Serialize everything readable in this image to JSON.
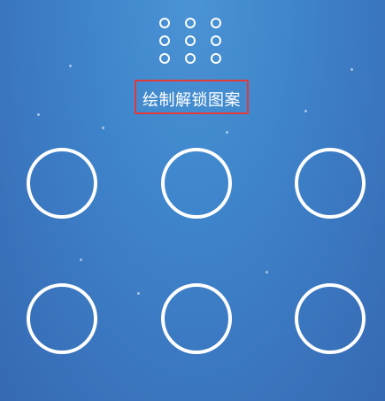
{
  "header": {
    "pattern_preview_icon": "grid-3x3-dots-icon",
    "title": "绘制解锁图案",
    "highlight_color": "#e23a3a"
  },
  "pattern_pad": {
    "node_color": "#ffffff",
    "visible_nodes": 6
  },
  "background": {
    "colors": [
      "#4a93d4",
      "#3669b3"
    ]
  }
}
